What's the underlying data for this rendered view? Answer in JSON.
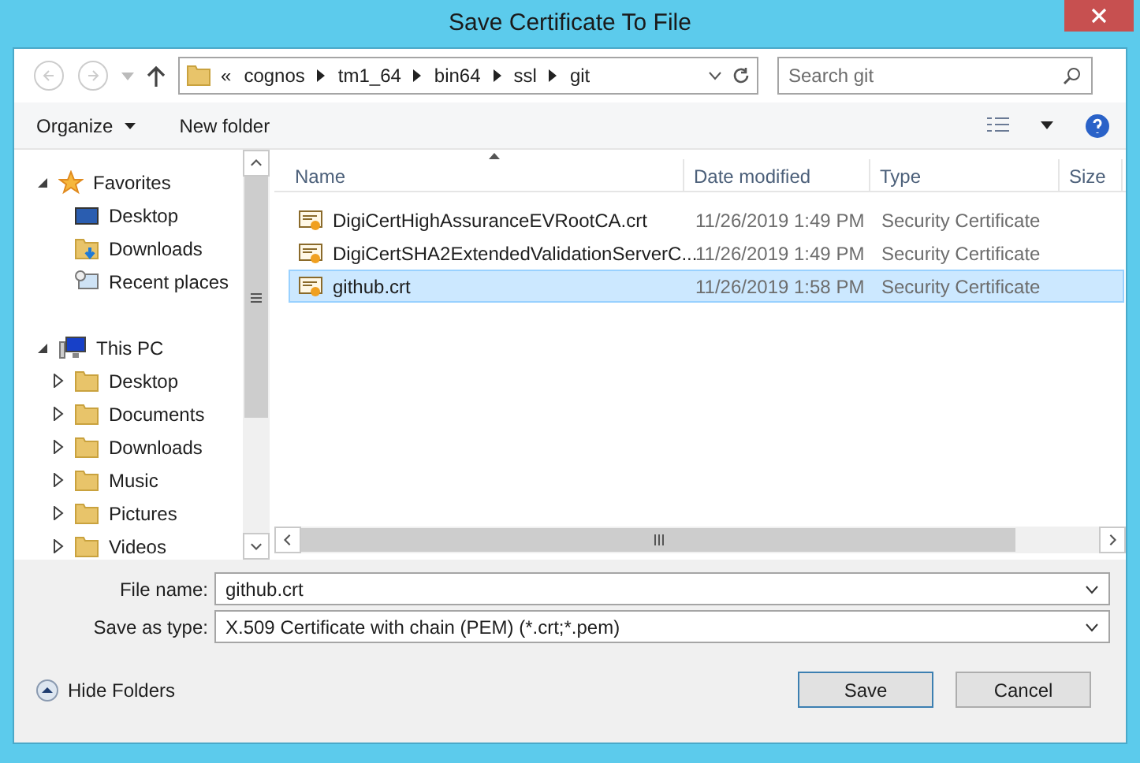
{
  "window": {
    "title": "Save Certificate To File"
  },
  "address_bar": {
    "overflow": "«",
    "path": [
      "cognos",
      "tm1_64",
      "bin64",
      "ssl",
      "git"
    ]
  },
  "search": {
    "placeholder": "Search git"
  },
  "toolbar": {
    "organize": "Organize",
    "new_folder": "New folder"
  },
  "nav_tree": [
    {
      "label": "Favorites",
      "kind": "favorites",
      "expanded": true,
      "children": [
        {
          "label": "Desktop",
          "kind": "desktop"
        },
        {
          "label": "Downloads",
          "kind": "downloads"
        },
        {
          "label": "Recent places",
          "kind": "recent"
        }
      ]
    },
    {
      "label": "This PC",
      "kind": "pc",
      "expanded": true,
      "children": [
        {
          "label": "Desktop",
          "kind": "folder",
          "expanded": false
        },
        {
          "label": "Documents",
          "kind": "folder",
          "expanded": false
        },
        {
          "label": "Downloads",
          "kind": "folder",
          "expanded": false
        },
        {
          "label": "Music",
          "kind": "folder",
          "expanded": false
        },
        {
          "label": "Pictures",
          "kind": "folder",
          "expanded": false
        },
        {
          "label": "Videos",
          "kind": "folder",
          "expanded": false
        }
      ]
    }
  ],
  "file_list": {
    "columns": [
      "Name",
      "Date modified",
      "Type",
      "Size"
    ],
    "rows": [
      {
        "name": "DigiCertHighAssuranceEVRootCA.crt",
        "date": "11/26/2019 1:49 PM",
        "type": "Security Certificate",
        "selected": false
      },
      {
        "name": "DigiCertSHA2ExtendedValidationServerC...",
        "date": "11/26/2019 1:49 PM",
        "type": "Security Certificate",
        "selected": false
      },
      {
        "name": "github.crt",
        "date": "11/26/2019 1:58 PM",
        "type": "Security Certificate",
        "selected": true
      }
    ]
  },
  "file_name": {
    "label": "File name:",
    "value": "github.crt"
  },
  "save_as_type": {
    "label": "Save as type:",
    "value": "X.509 Certificate with chain (PEM) (*.crt;*.pem)"
  },
  "hide_folders": "Hide Folders",
  "buttons": {
    "save": "Save",
    "cancel": "Cancel"
  }
}
